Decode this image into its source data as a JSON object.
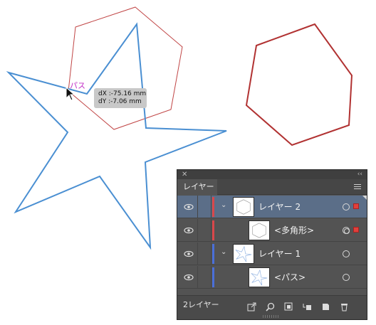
{
  "canvas": {
    "path_hint": "パス",
    "tooltip": {
      "dx": "dX :-75.16 mm",
      "dy": "dY :-7.06 mm"
    }
  },
  "layers_panel": {
    "tab_label": "レイヤー",
    "layers": [
      {
        "name": "レイヤー 2",
        "color": "#d9474a",
        "expanded": true,
        "selected": true
      },
      {
        "name": "<多角形>",
        "color": "#d9474a",
        "expanded": false,
        "selected": false
      },
      {
        "name": "レイヤー 1",
        "color": "#4a6fd9",
        "expanded": true,
        "selected": false
      },
      {
        "name": "<パス>",
        "color": "#4a6fd9",
        "expanded": false,
        "selected": false
      }
    ],
    "footer": {
      "layer_count": "2レイヤー",
      "icons": [
        "export-icon",
        "search-icon",
        "clipping-mask-icon",
        "new-sublayer-icon",
        "new-layer-icon",
        "trash-icon"
      ]
    }
  },
  "colors": {
    "star_stroke": "#4a8fd2",
    "hexagon_stroke": "#b13232",
    "panel_bg": "#535353",
    "selected_row": "#5b6e88"
  }
}
